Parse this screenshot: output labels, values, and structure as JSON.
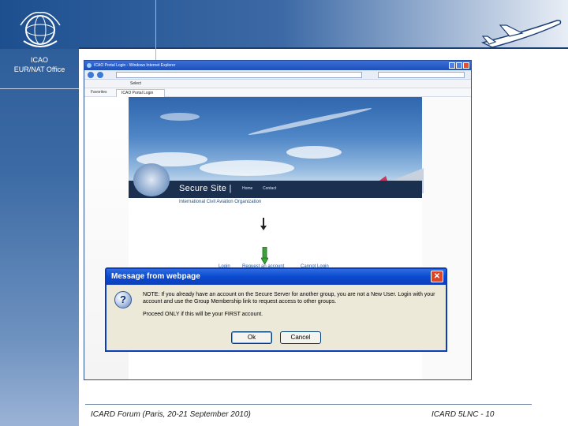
{
  "slide": {
    "office_line1": "ICAO",
    "office_line2": "EUR/NAT Office",
    "footer_left": "ICARD Forum (Paris, 20-21 September 2010)",
    "footer_right": "ICARD 5LNC - 10",
    "colors": {
      "band": "#2a5a97",
      "accent": "#1a3f75"
    }
  },
  "browser": {
    "window_title": "ICAO Portal Login - Windows Internet Explorer",
    "menu_items": [
      "Select"
    ],
    "favorites_label": "Favorites",
    "tab_label": "ICAO Portal Login",
    "site": {
      "banner_title": "Secure Site |",
      "nav_home": "Home",
      "nav_contact": "Contact",
      "subtitle": "International Civil Aviation Organization",
      "link_login": "Login",
      "link_request": "Request an account",
      "link_cannot": "Cannot Login"
    }
  },
  "dialog": {
    "title": "Message from webpage",
    "message_1": "NOTE: If you already have an account on the Secure Server for another group, you are not a New User. Login with your account and use the Group Membership link to request access to other groups.",
    "message_2": "Proceed ONLY if this will be your FIRST account.",
    "ok_label": "Ok",
    "cancel_label": "Cancel",
    "icons": [
      "question-icon",
      "close-icon"
    ]
  }
}
